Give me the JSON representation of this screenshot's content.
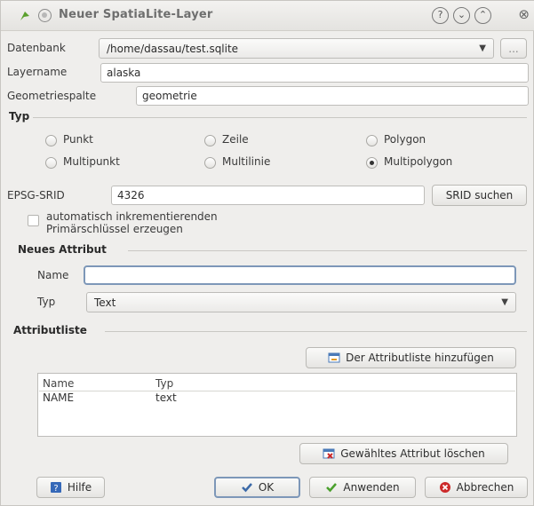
{
  "window": {
    "title": "Neuer SpatiaLite-Layer"
  },
  "titlebar_buttons": [
    "?",
    "⌄",
    "⌃",
    "⊗"
  ],
  "datenbank": {
    "label": "Datenbank",
    "value": "/home/dassau/test.sqlite",
    "browse_label": "..."
  },
  "layername": {
    "label": "Layername",
    "value": "alaska"
  },
  "geometriespalte": {
    "label": "Geometriespalte",
    "value": "geometrie"
  },
  "typ_section": {
    "title": "Typ",
    "options": [
      {
        "label": "Punkt",
        "selected": false
      },
      {
        "label": "Zeile",
        "selected": false
      },
      {
        "label": "Polygon",
        "selected": false
      },
      {
        "label": "Multipunkt",
        "selected": false
      },
      {
        "label": "Multilinie",
        "selected": false
      },
      {
        "label": "Multipolygon",
        "selected": true
      }
    ]
  },
  "epsg": {
    "label": "EPSG-SRID",
    "value": "4326",
    "search_label": "SRID suchen"
  },
  "primary_key": {
    "line1": "automatisch inkrementierenden",
    "line2": "Primärschlüssel erzeugen",
    "checked": false
  },
  "neues_attribut": {
    "title": "Neues Attribut",
    "name_label": "Name",
    "name_value": "",
    "typ_label": "Typ",
    "typ_value": "Text"
  },
  "attributliste": {
    "title": "Attributliste",
    "add_label": "Der Attributliste hinzufügen",
    "columns": [
      "Name",
      "Typ"
    ],
    "rows": [
      {
        "name": "NAME",
        "typ": "text"
      }
    ],
    "delete_label": "Gewähltes Attribut löschen"
  },
  "footer": {
    "help": "Hilfe",
    "ok": "OK",
    "apply": "Anwenden",
    "cancel": "Abbrechen"
  },
  "colors": {
    "background": "#efeeec",
    "focus": "#7d97b8",
    "ok_check": "#3c6aa8",
    "apply_check": "#4aa02c",
    "cancel_red": "#cc2a2a",
    "help_blue": "#3568b8"
  }
}
